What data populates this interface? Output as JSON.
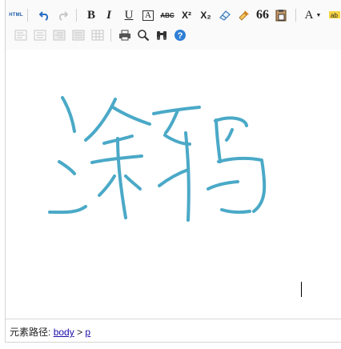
{
  "toolbar": {
    "html_label": "HTML",
    "bold_label": "B",
    "italic_label": "I",
    "underline_label": "U",
    "fontborder_label": "A",
    "strike_label": "ABC",
    "superscript_label": "X²",
    "subscript_label": "X₂",
    "quote_label": "66",
    "forecolor_label": "A",
    "icons": [
      "source-html",
      "undo",
      "redo",
      "bold",
      "italic",
      "underline",
      "font-border",
      "strikethrough",
      "superscript",
      "subscript",
      "eraser",
      "format-brush",
      "blockquote",
      "paste-plain",
      "font-color",
      "dropdown",
      "highlight",
      "justify-left",
      "justify-center",
      "justify-right",
      "justify-justify",
      "table",
      "print",
      "preview",
      "search-replace",
      "help"
    ],
    "accent_color": "#1d5ca8"
  },
  "drawing": {
    "stroke_color": "#4aa9c7"
  },
  "status": {
    "label": "元素路径:",
    "path_body": "body",
    "separator": ">",
    "path_p": "p"
  }
}
